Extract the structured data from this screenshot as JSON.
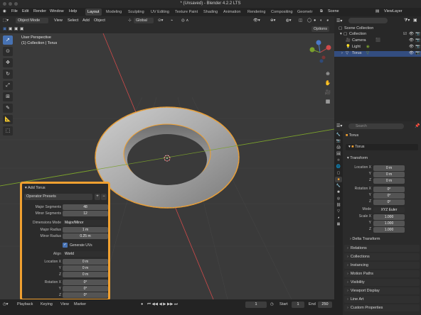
{
  "window": {
    "title": "* (Unsaved) - Blender 4.2.2 LTS"
  },
  "menu": {
    "items": [
      "File",
      "Edit",
      "Render",
      "Window",
      "Help"
    ]
  },
  "workspace_tabs": [
    {
      "label": "Layout",
      "active": true
    },
    {
      "label": "Modeling",
      "active": false
    },
    {
      "label": "Sculpting",
      "active": false
    },
    {
      "label": "UV Editing",
      "active": false
    },
    {
      "label": "Texture Paint",
      "active": false
    },
    {
      "label": "Shading",
      "active": false
    },
    {
      "label": "Animation",
      "active": false
    },
    {
      "label": "Rendering",
      "active": false
    },
    {
      "label": "Compositing",
      "active": false
    },
    {
      "label": "Geometr",
      "active": false
    }
  ],
  "scene": {
    "label": "Scene",
    "view_layer": "ViewLayer"
  },
  "viewport_header": {
    "mode": "Object Mode",
    "view": "View",
    "select": "Select",
    "add": "Add",
    "object": "Object",
    "transform_orientation": "Global",
    "options": "Options"
  },
  "viewport": {
    "perspective": "User Perspective",
    "collection_info": "(1) Collection | Torus"
  },
  "operator_panel": {
    "title": "Add Torus",
    "presets": "Operator Presets",
    "rows": [
      {
        "label": "Major Segments",
        "value": "48"
      },
      {
        "label": "Minor Segments",
        "value": "12"
      },
      {
        "label": "Dimensions Mode",
        "value": "Major/Minor"
      },
      {
        "label": "Major Radius",
        "value": "1 m"
      },
      {
        "label": "Minor Radius",
        "value": "0.25 m"
      },
      {
        "label": "Generate UVs",
        "value": ""
      },
      {
        "label": "Align",
        "value": "World"
      },
      {
        "label": "Location X",
        "value": "0 m"
      },
      {
        "label": "Y",
        "value": "0 m"
      },
      {
        "label": "Z",
        "value": "0 m"
      },
      {
        "label": "Rotation X",
        "value": "0°"
      },
      {
        "label": "Y",
        "value": "0°"
      },
      {
        "label": "Z",
        "value": "0°"
      }
    ]
  },
  "timeline": {
    "playback": "Playback",
    "keying": "Keying",
    "view": "View",
    "marker": "Marker",
    "current_frame": "1",
    "start_label": "Start",
    "start": "1",
    "end_label": "End",
    "end": "250"
  },
  "outliner": {
    "root": "Scene Collection",
    "items": [
      {
        "label": "Collection",
        "selected": false
      },
      {
        "label": "Camera",
        "selected": false
      },
      {
        "label": "Light",
        "selected": false
      },
      {
        "label": "Torus",
        "selected": true
      }
    ]
  },
  "properties": {
    "search_placeholder": "Search",
    "object_name_header": "Torus",
    "object_name_field": "Torus",
    "transform": "Transform",
    "location": [
      {
        "label": "Location X",
        "value": "0 m"
      },
      {
        "label": "Y",
        "value": "0 m"
      },
      {
        "label": "Z",
        "value": "0 m"
      }
    ],
    "rotation": [
      {
        "label": "Rotation X",
        "value": "0°"
      },
      {
        "label": "Y",
        "value": "0°"
      },
      {
        "label": "Z",
        "value": "0°"
      }
    ],
    "mode_label": "Mode",
    "mode_value": "XYZ Euler",
    "scale": [
      {
        "label": "Scale X",
        "value": "1.000"
      },
      {
        "label": "Y",
        "value": "1.000"
      },
      {
        "label": "Z",
        "value": "1.000"
      }
    ],
    "delta_transform": "Delta Transform",
    "sections": [
      "Relations",
      "Collections",
      "Instancing",
      "Motion Paths",
      "Visibility",
      "Viewport Display",
      "Line Art",
      "Custom Properties"
    ]
  },
  "colors": {
    "accent_orange": "#f0a030",
    "selection_blue": "#4772b3",
    "axis_x_red": "#d04a4a",
    "axis_y_green": "#7aa02c",
    "axis_z_blue": "#4a78c8"
  }
}
